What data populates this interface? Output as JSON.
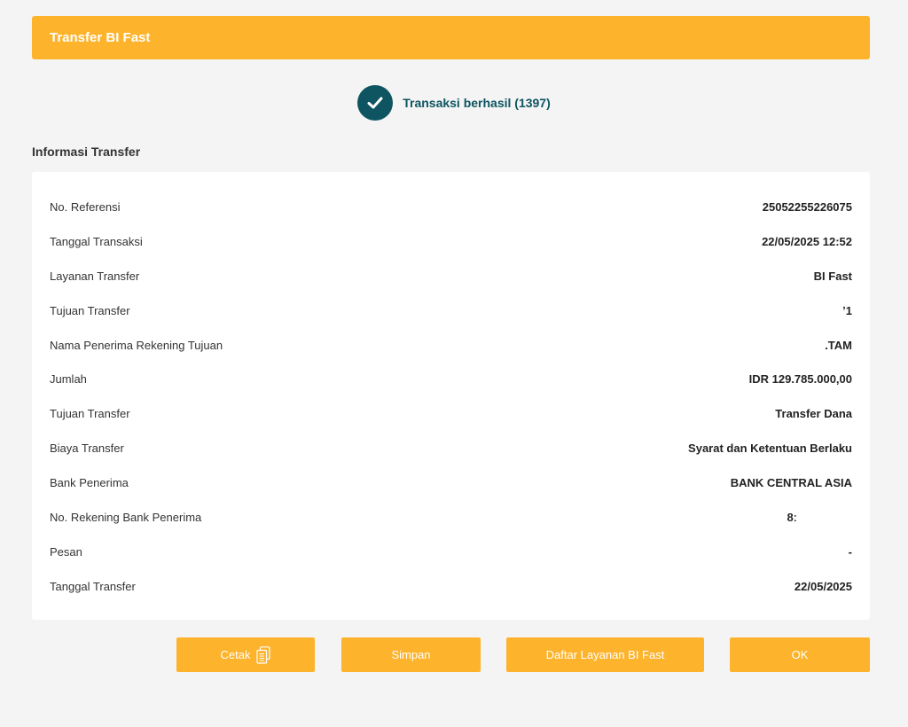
{
  "header": {
    "title": "Transfer BI Fast"
  },
  "status": {
    "icon": "check-icon",
    "text": "Transaksi berhasil (1397)"
  },
  "section": {
    "title": "Informasi Transfer"
  },
  "details": [
    {
      "label": "No. Referensi",
      "value": "25052255226075"
    },
    {
      "label": "Tanggal Transaksi",
      "value": "22/05/2025 12:52"
    },
    {
      "label": "Layanan Transfer",
      "value": "BI Fast"
    },
    {
      "label": "Tujuan Transfer",
      "value": "ʼ1"
    },
    {
      "label": "Nama Penerima Rekening Tujuan",
      "value": ".TAM"
    },
    {
      "label": "Jumlah",
      "value": "IDR 129.785.000,00"
    },
    {
      "label": "Tujuan Transfer",
      "value": "Transfer Dana"
    },
    {
      "label": "Biaya Transfer",
      "value": "Syarat dan Ketentuan Berlaku"
    },
    {
      "label": "Bank Penerima",
      "value": "BANK CENTRAL ASIA"
    },
    {
      "label": "No. Rekening Bank Penerima",
      "value": "8ː"
    },
    {
      "label": "Pesan",
      "value": "-"
    },
    {
      "label": "Tanggal Transfer",
      "value": "22/05/2025"
    }
  ],
  "buttons": {
    "print_label": "Cetak",
    "print_icon": "document-icon",
    "save_label": "Simpan",
    "list_label": "Daftar Layanan BI Fast",
    "ok_label": "OK"
  },
  "colors": {
    "accent": "#fdb32b",
    "success": "#0e5561",
    "background": "#f4f4f4",
    "card": "#ffffff"
  }
}
